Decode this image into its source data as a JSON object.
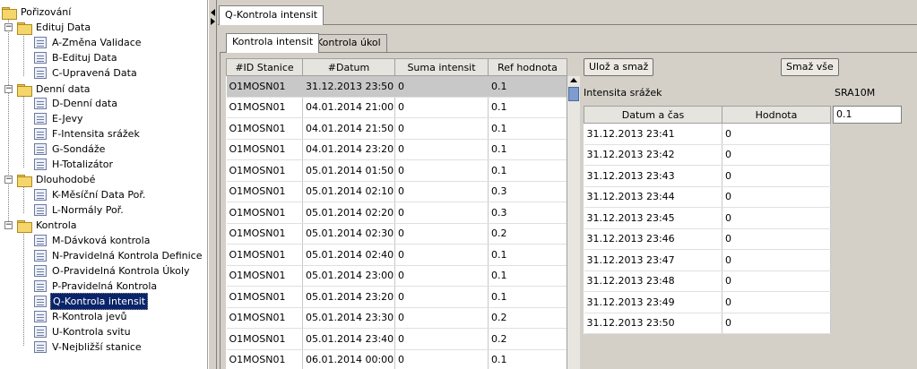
{
  "tree": {
    "root": "Pořizování",
    "groups": [
      {
        "label": "Edituj Data",
        "items": [
          "A-Změna Validace",
          "B-Edituj Data",
          "C-Upravená Data"
        ]
      },
      {
        "label": "Denní data",
        "items": [
          "D-Denní data",
          "E-Jevy",
          "F-Intensita srážek",
          "G-Sondáže",
          "H-Totalizátor"
        ]
      },
      {
        "label": "Dlouhodobé",
        "items": [
          "K-Měsíční Data Poř.",
          "L-Normály Poř."
        ]
      },
      {
        "label": "Kontrola",
        "items": [
          "M-Dávková kontrola",
          "N-Pravidelná Kontrola Definice",
          "O-Pravidelná Kontrola Úkoly",
          "P-Pravidelná Kontrola",
          "Q-Kontrola intensit",
          "R-Kontrola jevů",
          "U-Kontrola svitu",
          "V-Nejbližší stanice"
        ]
      }
    ],
    "selected": "Q-Kontrola intensit"
  },
  "window_tab": "Q-Kontrola intensit",
  "tabs": [
    "Kontrola intensit",
    "Kontrola úkol"
  ],
  "main_table": {
    "headers": [
      "#ID Stanice",
      "#Datum",
      "Suma intensit",
      "Ref hodnota"
    ],
    "rows": [
      [
        "O1MOSN01",
        "31.12.2013 23:50",
        "0",
        "0.1"
      ],
      [
        "O1MOSN01",
        "04.01.2014 21:00",
        "0",
        "0.1"
      ],
      [
        "O1MOSN01",
        "04.01.2014 21:50",
        "0",
        "0.1"
      ],
      [
        "O1MOSN01",
        "04.01.2014 23:20",
        "0",
        "0.1"
      ],
      [
        "O1MOSN01",
        "05.01.2014 01:50",
        "0",
        "0.1"
      ],
      [
        "O1MOSN01",
        "05.01.2014 02:10",
        "0",
        "0.3"
      ],
      [
        "O1MOSN01",
        "05.01.2014 02:20",
        "0",
        "0.3"
      ],
      [
        "O1MOSN01",
        "05.01.2014 02:30",
        "0",
        "0.2"
      ],
      [
        "O1MOSN01",
        "05.01.2014 02:40",
        "0",
        "0.1"
      ],
      [
        "O1MOSN01",
        "05.01.2014 23:00",
        "0",
        "0.1"
      ],
      [
        "O1MOSN01",
        "05.01.2014 23:20",
        "0",
        "0.1"
      ],
      [
        "O1MOSN01",
        "05.01.2014 23:30",
        "0",
        "0.2"
      ],
      [
        "O1MOSN01",
        "05.01.2014 23:40",
        "0",
        "0.2"
      ],
      [
        "O1MOSN01",
        "06.01.2014 00:00",
        "0",
        "0.1"
      ]
    ]
  },
  "buttons": {
    "save_delete": "Ulož a smaž",
    "delete_all": "Smaž vše"
  },
  "detail": {
    "label": "Intensita srážek",
    "code": "SRA10M",
    "value": "0.1",
    "headers": [
      "Datum a čas",
      "Hodnota"
    ],
    "rows": [
      [
        "31.12.2013 23:41",
        "0"
      ],
      [
        "31.12.2013 23:42",
        "0"
      ],
      [
        "31.12.2013 23:43",
        "0"
      ],
      [
        "31.12.2013 23:44",
        "0"
      ],
      [
        "31.12.2013 23:45",
        "0"
      ],
      [
        "31.12.2013 23:46",
        "0"
      ],
      [
        "31.12.2013 23:47",
        "0"
      ],
      [
        "31.12.2013 23:48",
        "0"
      ],
      [
        "31.12.2013 23:49",
        "0"
      ],
      [
        "31.12.2013 23:50",
        "0"
      ]
    ]
  }
}
